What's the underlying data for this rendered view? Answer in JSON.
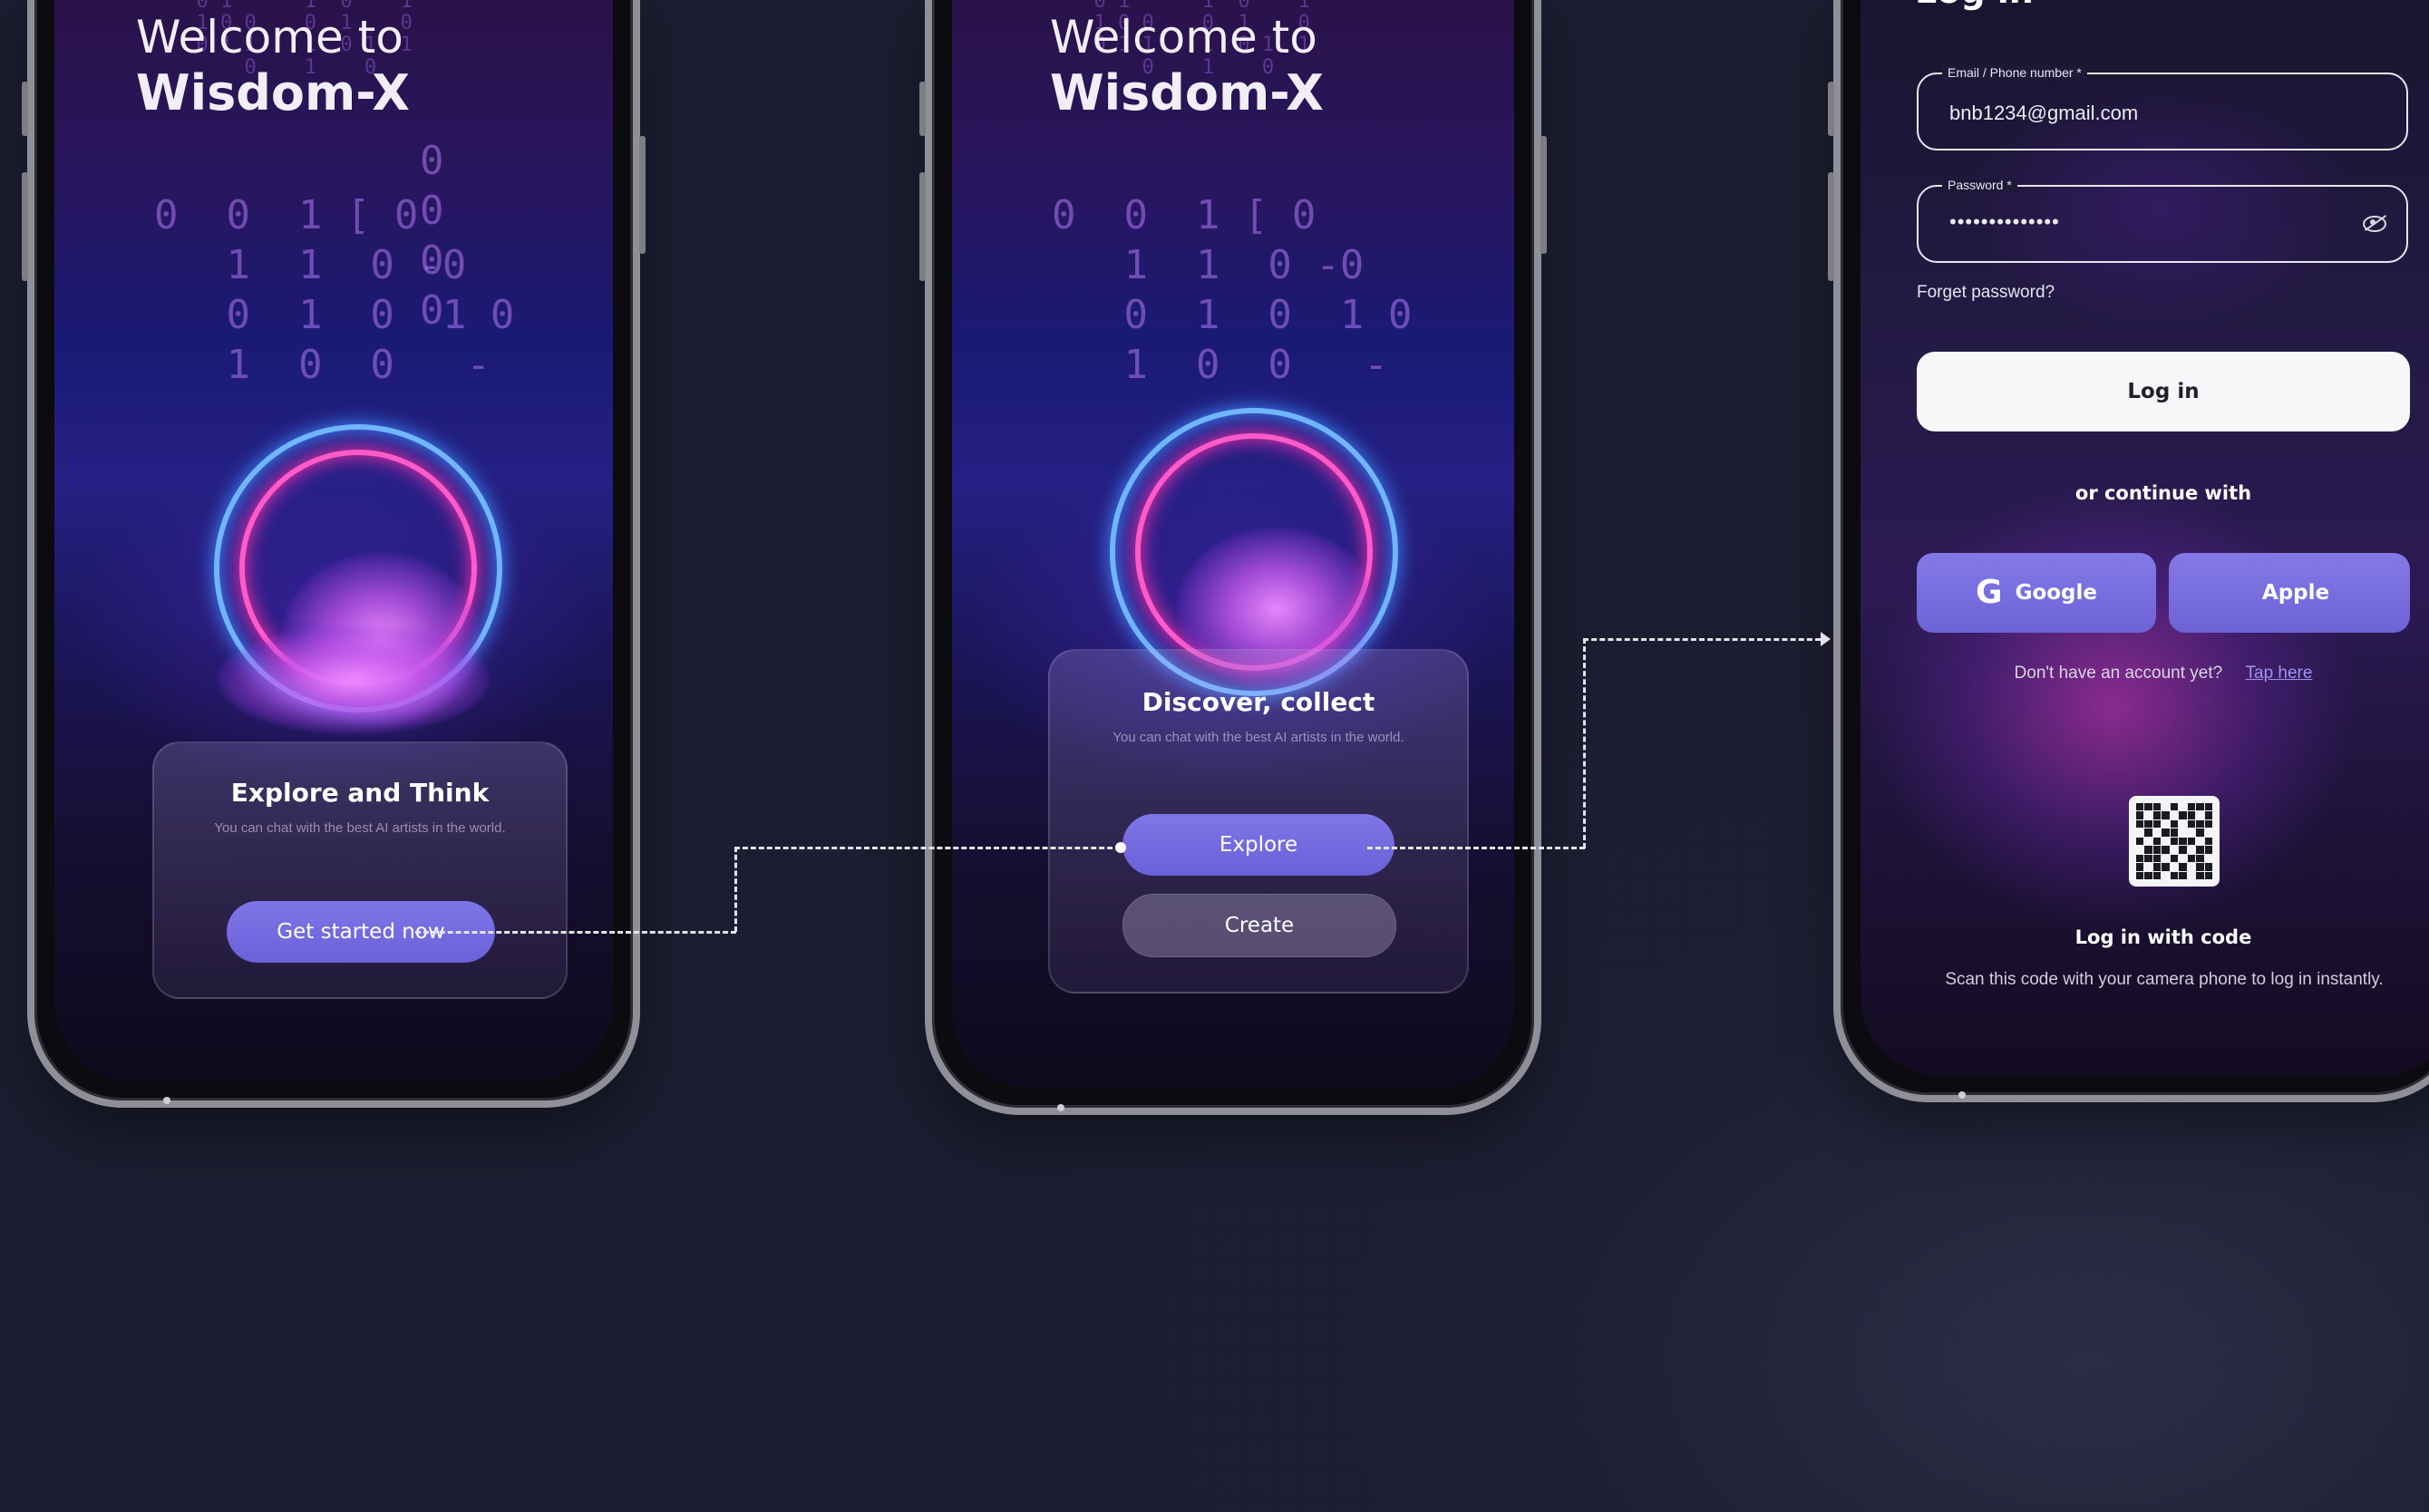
{
  "screen1": {
    "welcome_line1": "Welcome to",
    "welcome_line2": "Wisdom-X",
    "card_title": "Explore and Think",
    "card_subtitle": "You can chat with the best AI artists in the world.",
    "cta_label": "Get started now"
  },
  "screen2": {
    "welcome_line1": "Welcome to",
    "welcome_line2": "Wisdom-X",
    "card_title": "Discover, collect",
    "card_subtitle": "You can chat with the best AI artists in the world.",
    "explore_label": "Explore",
    "create_label": "Create"
  },
  "screen3": {
    "title": "Log in",
    "email_label": "Email / Phone number *",
    "email_value": "bnb1234@gmail.com",
    "password_label": "Password *",
    "password_value": "••••••••••••••",
    "forgot_label": "Forget password?",
    "login_label": "Log in",
    "divider_label": "or continue with",
    "google_label": "Google",
    "apple_label": "Apple",
    "google_icon": "G",
    "apple_icon": "",
    "no_account_text": "Don't have an account yet?",
    "tap_here_label": "Tap here",
    "code_title": "Log in with code",
    "code_desc": "Scan this code with your camera phone to log in instantly."
  },
  "colors": {
    "background": "#1e1f33",
    "accent_violet": "#7f76e8",
    "neon_pink": "#ff5ac8",
    "neon_blue": "#6fb6ff"
  }
}
